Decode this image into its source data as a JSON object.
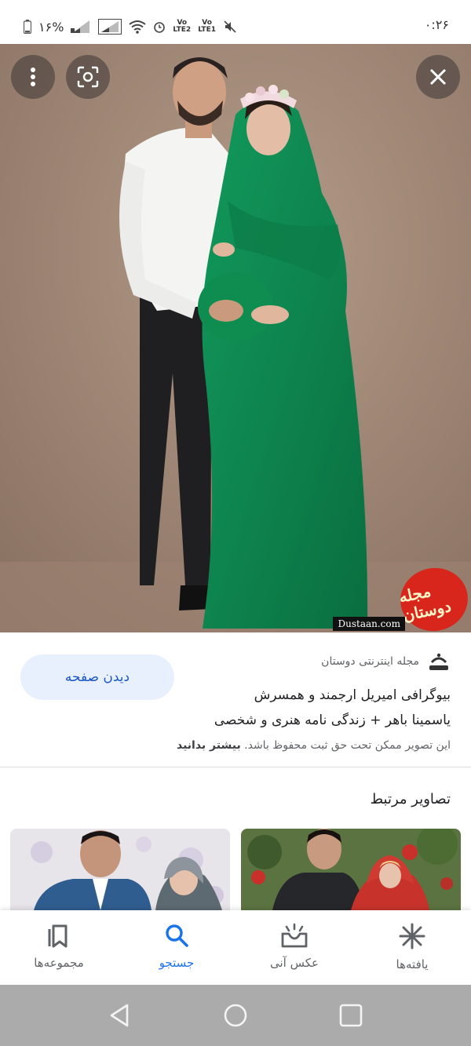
{
  "status_bar": {
    "battery": "١۶%",
    "lte2": "LTE2",
    "lte1": "LTE1",
    "vo": "Vo",
    "time": "٠:٢۶",
    "icons": [
      "battery-icon",
      "signal-icon",
      "signal-icon",
      "wifi-icon",
      "alarm-icon",
      "mute-icon"
    ]
  },
  "viewer": {
    "menu_icon": "more-vert-icon",
    "lens_icon": "lens-icon",
    "close_icon": "close-icon",
    "watermark": {
      "seal_text": "مجله دوستان",
      "site": "Dustaan.com"
    }
  },
  "info": {
    "source_name": "مجله اینترنتی دوستان",
    "visit_label": "دیدن صفحه",
    "title_line1": "بیوگرافی امیریل ارجمند و همسرش",
    "title_line2": "یاسمینا باهر + زندگی نامه هنری و شخصی",
    "notice_text": "این تصویر ممکن تحت حق ثبت محفوظ باشد.",
    "learn_more": "بیشتر بدانید"
  },
  "related": {
    "title": "تصاویر مرتبط"
  },
  "bottom_nav": {
    "items": [
      {
        "label": "مجموعه‌ها",
        "icon": "bookmarks-icon"
      },
      {
        "label": "جستجو",
        "icon": "search-icon"
      },
      {
        "label": "عکس آنی",
        "icon": "snapshot-icon"
      },
      {
        "label": "یافته‌ها",
        "icon": "discover-icon"
      }
    ],
    "active": "جستجو"
  },
  "system_nav": {
    "icons": [
      "back-icon",
      "home-icon",
      "recents-icon"
    ]
  },
  "colors": {
    "accent": "#1a73e8",
    "visit_button_bg": "#e8f0fe",
    "dress_green": "#0e8a52",
    "backdrop": "#a78d7d",
    "watermark_red": "#d9261c",
    "system_nav_bg": "#ababab"
  }
}
